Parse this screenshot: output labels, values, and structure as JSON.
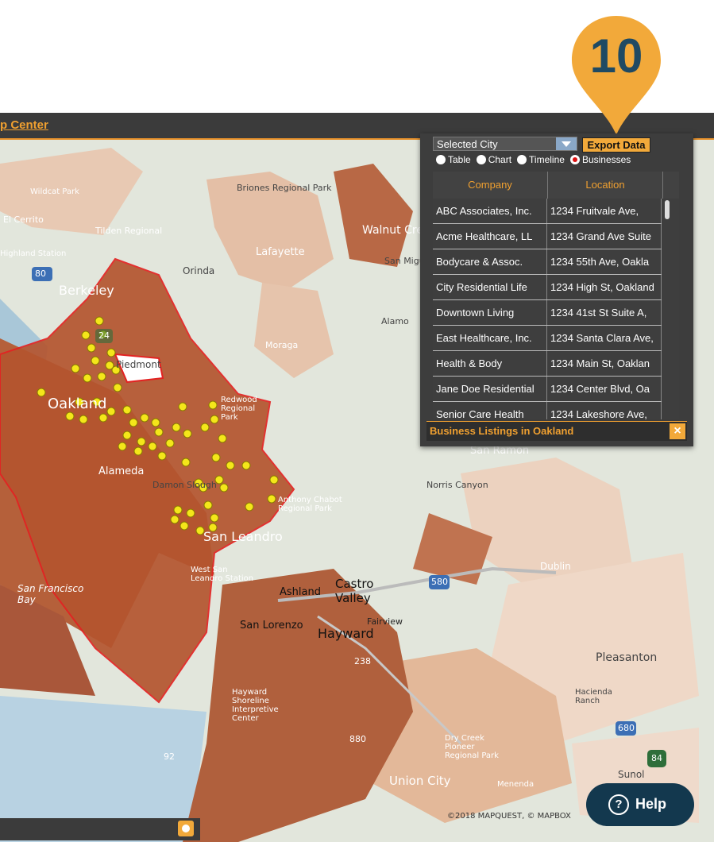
{
  "header": {
    "link_label": "p Center"
  },
  "marker": {
    "number": "10"
  },
  "panel": {
    "dropdown_value": "Selected City",
    "export_label": "Export Data",
    "options": [
      {
        "label": "Table",
        "selected": false
      },
      {
        "label": "Chart",
        "selected": false
      },
      {
        "label": "Timeline",
        "selected": false
      },
      {
        "label": "Businesses",
        "selected": true
      }
    ],
    "columns": [
      "Company",
      "Location"
    ],
    "rows": [
      {
        "company": "ABC Associates, Inc.",
        "location": "1234 Fruitvale Ave,"
      },
      {
        "company": "Acme Healthcare, LL",
        "location": "1234 Grand Ave Suite"
      },
      {
        "company": "Bodycare & Assoc.",
        "location": "1234 55th Ave, Oakla"
      },
      {
        "company": "City Residential Life",
        "location": "1234 High St, Oakland"
      },
      {
        "company": "Downtown Living",
        "location": "1234 41st St Suite A,"
      },
      {
        "company": "East Healthcare, Inc.",
        "location": "1234 Santa Clara Ave,"
      },
      {
        "company": "Health & Body",
        "location": "1234 Main St, Oaklan"
      },
      {
        "company": "Jane Doe Residential",
        "location": "1234 Center Blvd, Oa"
      },
      {
        "company": "Senior Care Health",
        "location": "1234 Lakeshore Ave,"
      }
    ],
    "footer_title": "Business Listings in Oakland",
    "close_symbol": "×"
  },
  "map": {
    "labels": [
      "Briones Regional Park",
      "Walnut Creek",
      "Lafayette",
      "Berkeley",
      "Orinda",
      "Moraga",
      "Piedmont",
      "Oakland",
      "Alameda",
      "Damon Slough",
      "San Leandro",
      "Anthony Chabot Regional Park",
      "Redwood Regional Park",
      "West San Leandro Station",
      "San Francisco Bay",
      "Castro Valley",
      "Ashland",
      "San Lorenzo",
      "Fairview",
      "Hayward",
      "Hayward Shoreline Interpretive Center",
      "Pleasanton",
      "Dublin",
      "San Ramon",
      "Norris Canyon",
      "Union City",
      "Sunol",
      "Dry Creek Pioneer Regional Park",
      "Menenda",
      "Hacienda Ranch",
      "Alamo",
      "Tilden Regional",
      "Highland Station",
      "El Cerrito",
      "Wildcat Park",
      "San Miguel"
    ],
    "highways": [
      "80",
      "680",
      "580",
      "24",
      "880",
      "238",
      "92",
      "84"
    ],
    "copyright": "©2018 MAPQUEST, © MAPBOX"
  },
  "help": {
    "label": "Help",
    "icon": "?"
  },
  "colors": {
    "accent": "#f0a030",
    "dark": "#3b3b3b",
    "help_bg": "#13384e",
    "marker": "#f2a93a",
    "region": "#b5603a"
  }
}
